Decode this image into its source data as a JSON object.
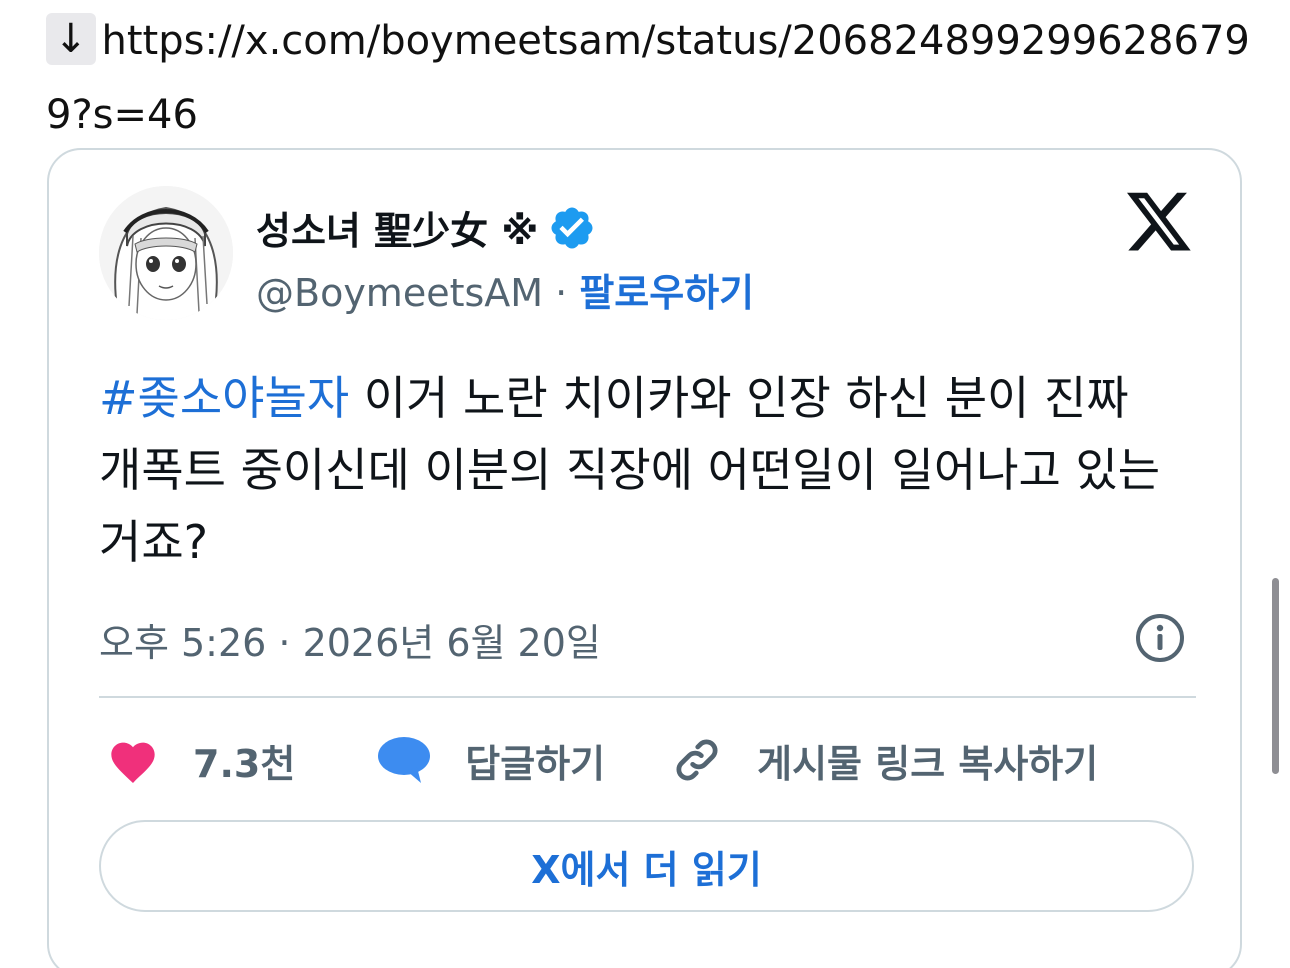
{
  "url_line": {
    "arrow": "↓",
    "url": "https://x.com/boymeetsam/status/2068248992996286799?s=46"
  },
  "tweet": {
    "display_name": "성소녀 聖少女 ※",
    "handle": "@BoymeetsAM",
    "separator": "·",
    "follow_label": "팔로우하기",
    "hashtag": "#좆소야놀자",
    "body": " 이거 노란 치이카와 인장 하신 분이 진짜 개폭트 중이신데 이분의 직장에 어떤일이 일어나고 있는거죠?",
    "timestamp": "오후 5:26 · 2026년 6월 20일",
    "like_count": "7.3천",
    "reply_label": "답글하기",
    "copy_link_label": "게시물 링크 복사하기",
    "read_more_label": "X에서 더 읽기"
  },
  "colors": {
    "link_blue": "#1d6fd6",
    "verified_blue": "#1d9bf0",
    "heart_pink": "#f0307b",
    "reply_blue": "#3d8cf0",
    "muted_text": "#536471",
    "border": "#cfd9de"
  },
  "icons": [
    "download-arrow-icon",
    "avatar-image",
    "verified-badge-icon",
    "x-logo-icon",
    "info-icon",
    "heart-icon",
    "reply-bubble-icon",
    "link-icon"
  ]
}
